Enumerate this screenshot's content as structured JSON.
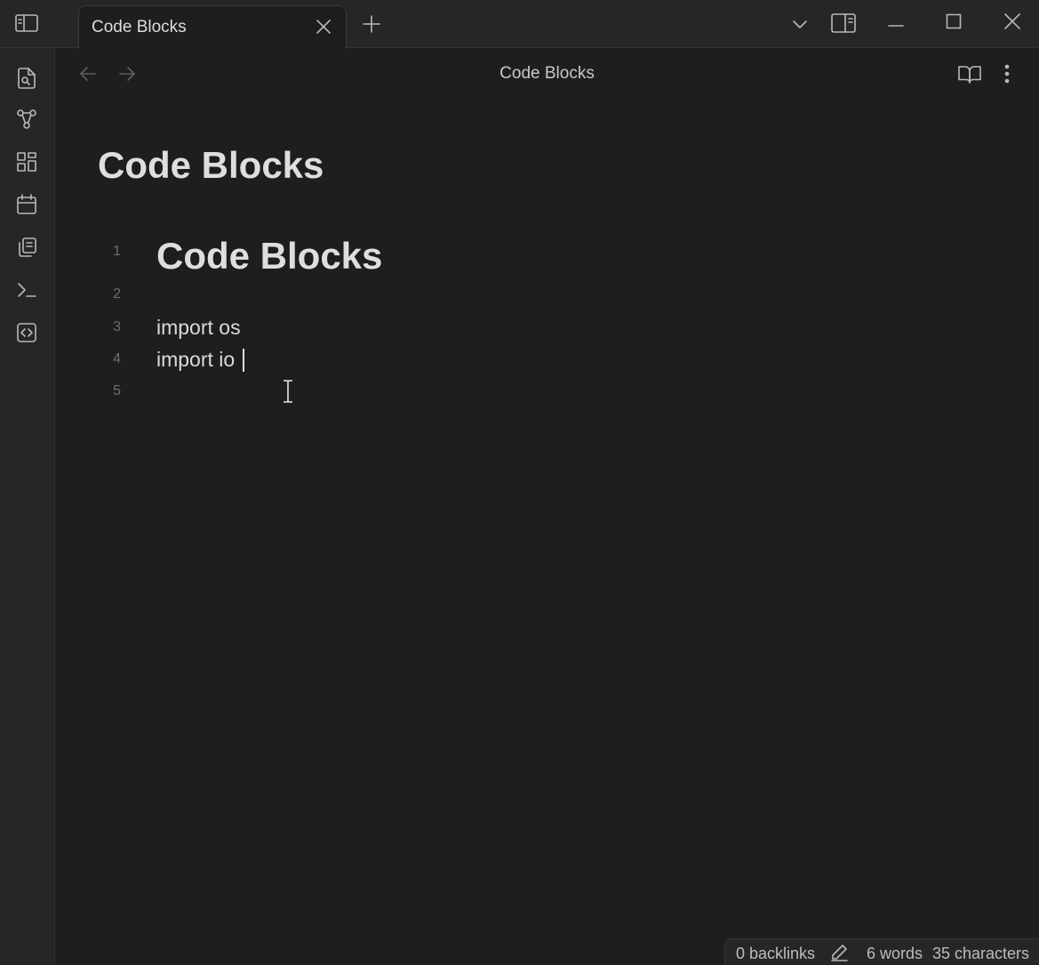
{
  "tab": {
    "title": "Code Blocks"
  },
  "view_header": {
    "title": "Code Blocks"
  },
  "note": {
    "inline_title": "Code Blocks"
  },
  "editor": {
    "lines": [
      {
        "number": "1",
        "text": "Code Blocks"
      },
      {
        "number": "2",
        "text": ""
      },
      {
        "number": "3",
        "text": "import os"
      },
      {
        "number": "4",
        "text": "import io"
      },
      {
        "number": "5",
        "text": ""
      }
    ]
  },
  "status_bar": {
    "backlinks": "0 backlinks",
    "words": "6 words",
    "characters": "35 characters"
  },
  "icons": {
    "sidebar_toggle": "sidebar-toggle-icon",
    "close_tab": "close-icon",
    "new_tab": "plus-icon",
    "tab_list": "chevron-down-icon",
    "right_sidebar": "right-sidebar-icon",
    "minimize": "minimize-icon",
    "maximize": "maximize-icon",
    "close_window": "close-icon",
    "ribbon": [
      "file-search-icon",
      "graph-icon",
      "layout-grid-icon",
      "calendar-icon",
      "copy-files-icon",
      "terminal-icon",
      "code-icon"
    ],
    "back": "arrow-left-icon",
    "forward": "arrow-right-icon",
    "reading_view": "book-open-icon",
    "more_options": "more-vertical-icon",
    "edit_mode": "pencil-icon"
  },
  "colors": {
    "background": "#1e1e1e",
    "chrome": "#262626",
    "text": "#dadada"
  }
}
